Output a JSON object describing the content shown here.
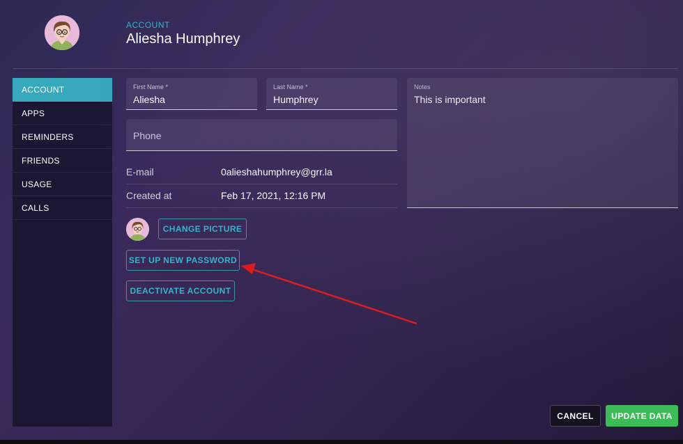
{
  "header": {
    "section_label": "ACCOUNT",
    "user_name": "Aliesha Humphrey"
  },
  "sidebar": {
    "items": [
      {
        "label": "ACCOUNT",
        "active": true
      },
      {
        "label": "APPS",
        "active": false
      },
      {
        "label": "REMINDERS",
        "active": false
      },
      {
        "label": "FRIENDS",
        "active": false
      },
      {
        "label": "USAGE",
        "active": false
      },
      {
        "label": "CALLS",
        "active": false
      }
    ]
  },
  "form": {
    "first_name": {
      "label": "First Name *",
      "value": "Aliesha"
    },
    "last_name": {
      "label": "Last Name *",
      "value": "Humphrey"
    },
    "phone": {
      "placeholder": "Phone",
      "value": ""
    },
    "notes": {
      "label": "Notes",
      "value": "This is important"
    }
  },
  "info": {
    "email_label": "E-mail",
    "email_value": "0alieshahumphrey@grr.la",
    "created_label": "Created at",
    "created_value": "Feb 17, 2021, 12:16 PM"
  },
  "actions": {
    "change_picture": "CHANGE PICTURE",
    "set_password": "SET UP NEW PASSWORD",
    "deactivate": "DEACTIVATE ACCOUNT",
    "cancel": "CANCEL",
    "update": "UPDATE DATA"
  },
  "colors": {
    "accent": "#33b6c8",
    "active_tab": "#36a9bd",
    "update_button": "#3dbb57",
    "annotation_arrow": "#e01b1b"
  }
}
